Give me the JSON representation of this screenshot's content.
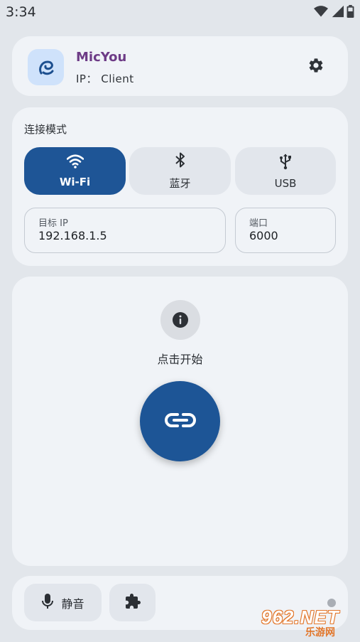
{
  "status_bar": {
    "time": "3:34",
    "icons": [
      "wifi-icon",
      "signal-icon",
      "battery-icon"
    ]
  },
  "header": {
    "app_name": "MicYou",
    "ip_label": "IP： Client",
    "logo_icon": "app-logo-icon",
    "settings_icon": "gear-icon"
  },
  "connection": {
    "title": "连接模式",
    "modes": [
      {
        "label": "Wi-Fi",
        "icon": "wifi-icon",
        "selected": true
      },
      {
        "label": "蓝牙",
        "icon": "bluetooth-icon",
        "selected": false
      },
      {
        "label": "USB",
        "icon": "usb-icon",
        "selected": false
      }
    ],
    "target_ip": {
      "label": "目标 IP",
      "value": "192.168.1.5"
    },
    "port": {
      "label": "端口",
      "value": "6000"
    }
  },
  "main": {
    "info_icon": "info-icon",
    "hint": "点击开始",
    "connect_icon": "link-icon"
  },
  "bottom": {
    "mute_label": "静音",
    "mute_icon": "mic-icon",
    "plugin_icon": "puzzle-icon"
  },
  "watermark": {
    "main": "962.NET",
    "sub": "乐游网"
  },
  "colors": {
    "background": "#e2e6eb",
    "card": "#f0f3f7",
    "accent": "#1e5596",
    "app_name": "#6d3b86",
    "watermark": "#e2762a"
  }
}
